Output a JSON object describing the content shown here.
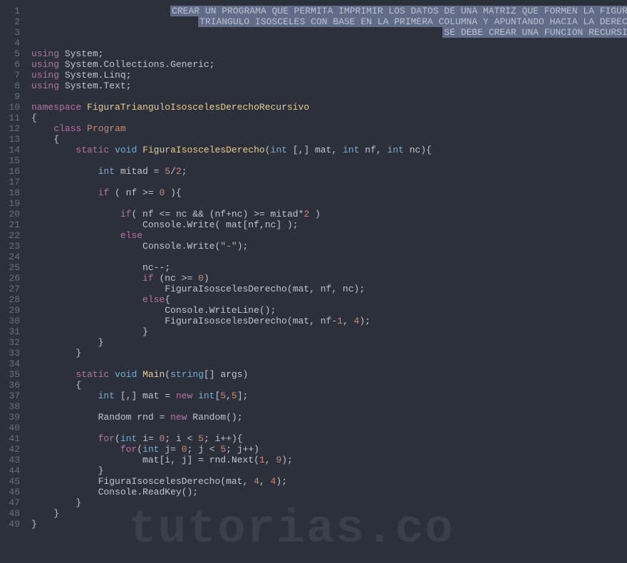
{
  "watermark": "tutorias.co",
  "comment": {
    "line1": "CREAR UN PROGRAMA QUE PERMITA IMPRIMIR LOS DATOS DE UNA MATRIZ QUE FORMEN LA FIGURA",
    "line2": "TRIANGULO ISOSCELES CON BASE EN LA PRIMERA COLUMNA Y APUNTANDO HACIA LA DERECHA",
    "line3": "SE DEBE CREAR UNA FUNCION RECURSIVA"
  },
  "lineNumbers": [
    "1",
    "2",
    "3",
    "4",
    "5",
    "6",
    "7",
    "8",
    "9",
    "10",
    "11",
    "12",
    "13",
    "14",
    "15",
    "16",
    "17",
    "18",
    "19",
    "20",
    "21",
    "22",
    "23",
    "24",
    "25",
    "26",
    "27",
    "28",
    "29",
    "30",
    "31",
    "32",
    "33",
    "34",
    "35",
    "36",
    "37",
    "38",
    "39",
    "40",
    "41",
    "42",
    "43",
    "44",
    "45",
    "46",
    "47",
    "48",
    "49"
  ],
  "tokens": {
    "using": "using",
    "namespace": "namespace",
    "class": "class",
    "static": "static",
    "void": "void",
    "int": "int",
    "if": "if",
    "else": "else",
    "new": "new",
    "for": "for",
    "string": "string",
    "System": "System",
    "SystemCollectionsGeneric": "System.Collections.Generic",
    "SystemLinq": "System.Linq",
    "SystemText": "System.Text",
    "nsName": "FiguraTrianguloIsoscelesDerechoRecursivo",
    "Program": "Program",
    "FiguraIsoscelesDerecho": "FiguraIsoscelesDerecho",
    "Main": "Main",
    "Console": "Console",
    "Write": "Write",
    "WriteLine": "WriteLine",
    "ReadKey": "ReadKey",
    "Random": "Random",
    "rnd": "rnd",
    "Next": "Next",
    "mat": "mat",
    "nf": "nf",
    "nc": "nc",
    "mitad": "mitad",
    "args": "args",
    "i": "i",
    "j": "j",
    "dashStr": "\"-\"",
    "n0": "0",
    "n1": "1",
    "n2": "2",
    "n4": "4",
    "n5": "5",
    "n9": "9"
  }
}
